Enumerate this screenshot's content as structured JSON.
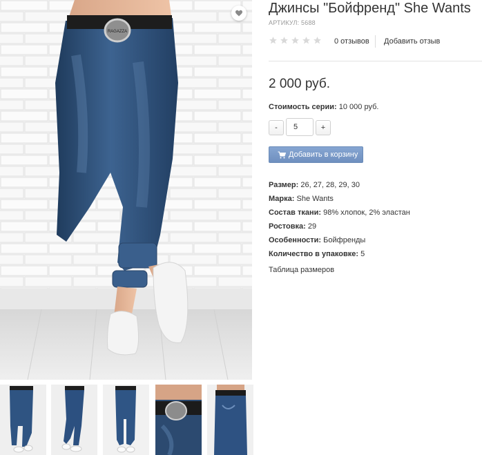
{
  "product": {
    "title": "Джинсы \"Бойфренд\" She Wants",
    "sku": "АРТИКУЛ: 5688",
    "rating": 0,
    "rating_max": 5,
    "reviews_count": "0 отзывов",
    "add_review": "Добавить отзыв",
    "price": "2 000 руб.",
    "series_label": "Стоимость серии:",
    "series_value": "10 000 руб.",
    "qty_minus": "-",
    "qty_value": "5",
    "qty_plus": "+",
    "add_to_cart": "Добавить в корзину",
    "size_table": "Таблица размеров"
  },
  "properties": [
    {
      "key": "Размер:",
      "value": "26, 27, 28, 29, 30"
    },
    {
      "key": "Марка:",
      "value": "She Wants"
    },
    {
      "key": "Состав ткани:",
      "value": "98% хлопок, 2% эластан"
    },
    {
      "key": "Ростовка:",
      "value": "29"
    },
    {
      "key": "Особенности:",
      "value": "Бойфренды"
    },
    {
      "key": "Количество в упаковке:",
      "value": "5"
    }
  ],
  "photo": {
    "main_alt_icon": "jeans-photo",
    "belt_text": "RAGAZZA",
    "thumbnails": [
      "front-view",
      "side-view",
      "front-full",
      "belt-closeup",
      "back-side-view"
    ]
  },
  "colors": {
    "button_blue": "#7797c6",
    "denim": "#2f4f73",
    "star_empty": "#d9d9d9"
  }
}
